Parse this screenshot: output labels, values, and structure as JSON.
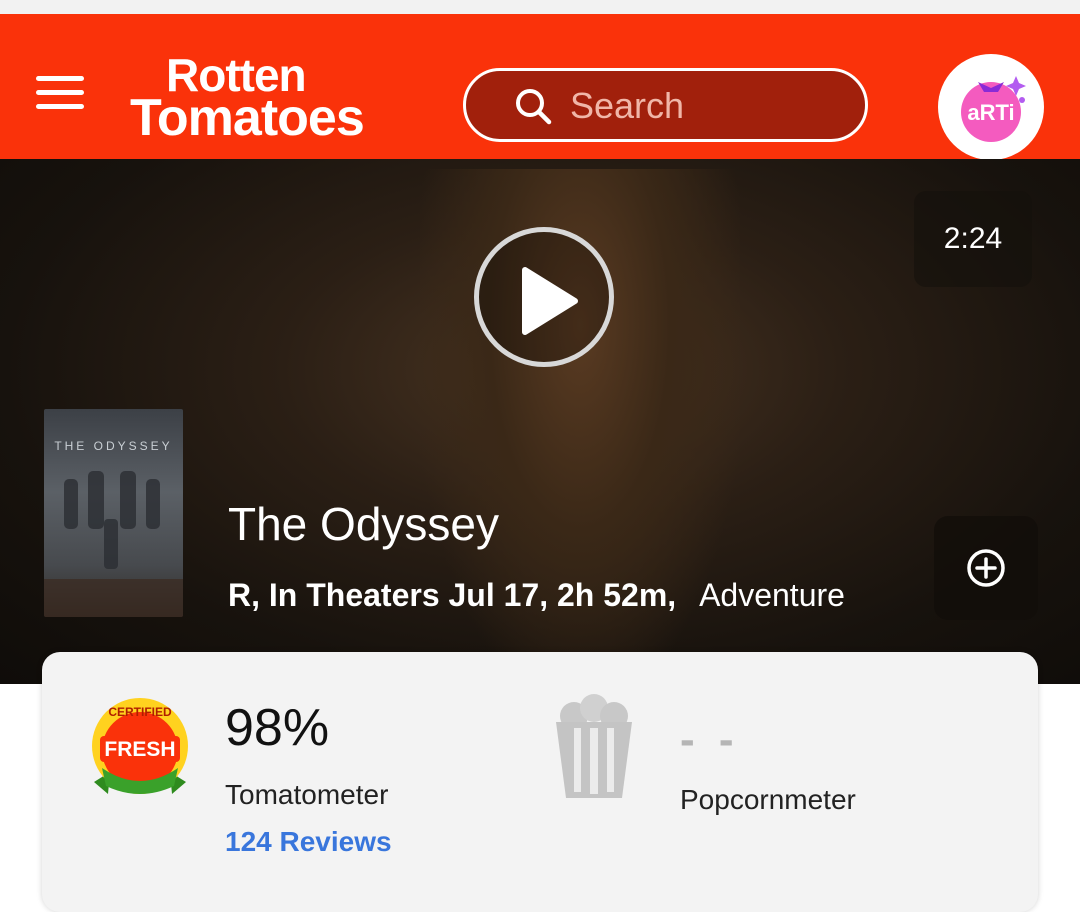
{
  "header": {
    "logo_line1": "Rotten",
    "logo_line2": "Tomatoes",
    "search_placeholder": "Search",
    "avatar_text": "aRTi"
  },
  "hero": {
    "duration": "2:24",
    "poster_title": "THE ODYSSEY",
    "title": "The Odyssey",
    "meta_strong": "R, In Theaters Jul 17, 2h 52m,",
    "genre": "Adventure"
  },
  "scores": {
    "badge_top": "CERTIFIED",
    "badge_middle": "FRESH",
    "tomatometer_value": "98%",
    "tomatometer_label": "Tomatometer",
    "reviews_link": "124 Reviews",
    "popcornmeter_value": "- -",
    "popcornmeter_label": "Popcornmeter"
  },
  "colors": {
    "brand": "#fa320a",
    "link": "#3976dc"
  }
}
